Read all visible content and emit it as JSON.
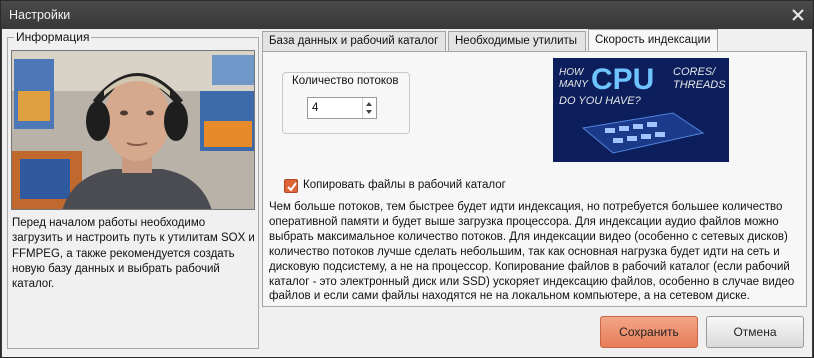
{
  "window": {
    "title": "Настройки"
  },
  "info_panel": {
    "legend": "Информация",
    "text": "Перед началом работы необходимо загрузить и настроить путь к утилитам SOX и FFMPEG, а также рекомендуется создать новую базу данных и выбрать рабочий каталог."
  },
  "tabs": [
    {
      "label": "База данных и рабочий каталог",
      "active": false
    },
    {
      "label": "Необходимые утилиты",
      "active": false
    },
    {
      "label": "Скорость индексации",
      "active": true
    }
  ],
  "indexing": {
    "threads_label": "Количество потоков",
    "threads_value": "4",
    "copy_label": "Копировать файлы в рабочий каталог",
    "copy_checked": true,
    "banner": {
      "line_how": "HOW",
      "line_many": "MANY",
      "cpu": "CPU",
      "cores": "CORES/",
      "threads": "THREADS",
      "question": "DO YOU HAVE?"
    },
    "description": "Чем больше потоков, тем быстрее будет идти индексация, но потребуется большее количество оперативной памяти и будет выше загрузка процессора. Для индексации аудио файлов можно выбрать максимальное количество потоков. Для индексации видео (особенно с сетевых дисков) количество потоков лучше сделать небольшим, так как основная нагрузка будет идти на сеть и дисковую подсистему, а не на процессор. Копирование файлов в рабочий каталог (если рабочий каталог - это электронный диск или SSD) ускоряет индексацию файлов, особенно в случае видео файлов и если сами файлы находятся не на локальном компьютере, а на сетевом диске."
  },
  "buttons": {
    "save": "Сохранить",
    "cancel": "Отмена"
  },
  "colors": {
    "accent": "#e77d58",
    "titlebar": "#3b3b3b",
    "banner_bg": "#0c1f5c",
    "banner_text": "#6fc3ff"
  }
}
